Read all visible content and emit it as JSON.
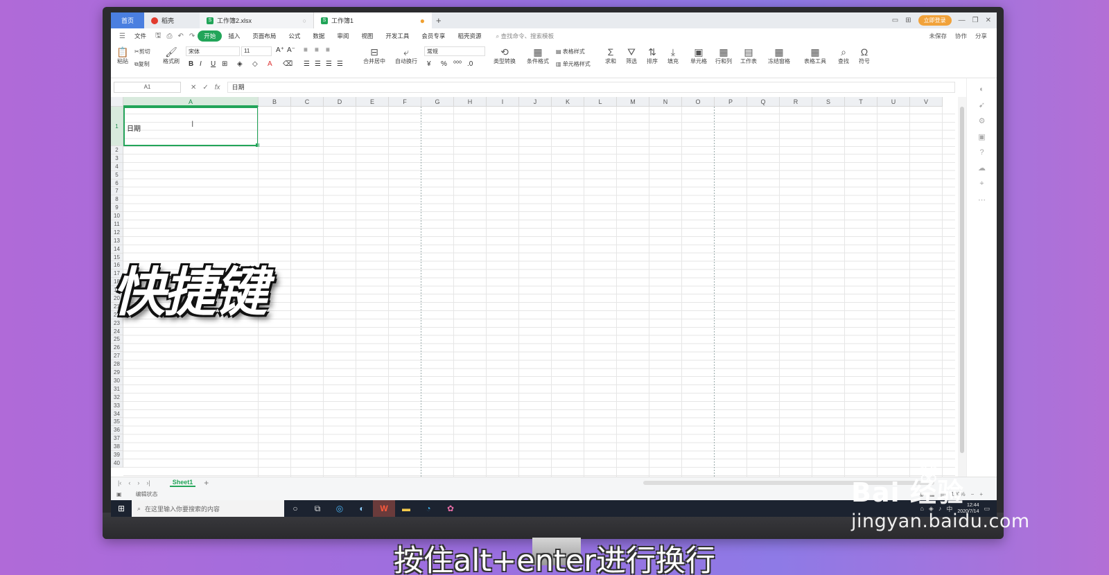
{
  "tabs": {
    "home": "首页",
    "docer": "稻壳",
    "file1": "工作簿2.xlsx",
    "active": "工作簿1",
    "new_tab": "+"
  },
  "title_bar": {
    "login": "立即登录"
  },
  "menu": {
    "file": "文件",
    "items": [
      "开始",
      "插入",
      "页面布局",
      "公式",
      "数据",
      "审阅",
      "视图",
      "开发工具",
      "会员专享",
      "稻壳资源"
    ],
    "active_index": 0,
    "search": "查找命令、搜索模板",
    "unsaved": "未保存",
    "collab": "协作",
    "share": "分享"
  },
  "ribbon": {
    "paste": "粘贴",
    "cut": "剪切",
    "copy": "复制",
    "format_painter": "格式刷",
    "font_name": "宋体",
    "font_size": "11",
    "merge_center": "合并居中",
    "wrap_text": "自动换行",
    "number_format": "常规",
    "type_convert": "类型转换",
    "cond_format": "条件格式",
    "table_style": "表格样式",
    "cell_style": "单元格样式",
    "sum": "求和",
    "filter": "筛选",
    "sort": "排序",
    "fill": "填充",
    "cell": "单元格",
    "row_col": "行和列",
    "worksheet": "工作表",
    "freeze": "冻结窗格",
    "table_tools": "表格工具",
    "find": "查找",
    "symbol": "符号"
  },
  "formula_bar": {
    "cell_ref": "A1",
    "fx": "fx",
    "value": "日期"
  },
  "grid": {
    "columns": [
      "A",
      "B",
      "C",
      "D",
      "E",
      "F",
      "G",
      "H",
      "I",
      "J",
      "K",
      "L",
      "M",
      "N",
      "O",
      "P",
      "Q",
      "R",
      "S",
      "T",
      "U",
      "V"
    ],
    "rows": [
      "1",
      "2",
      "3",
      "4",
      "5",
      "6",
      "7",
      "8",
      "9",
      "10",
      "11",
      "12",
      "13",
      "14",
      "15",
      "16",
      "17",
      "18",
      "19",
      "20",
      "21",
      "22",
      "23",
      "24",
      "25",
      "26",
      "27",
      "28",
      "29",
      "30",
      "31",
      "32",
      "33",
      "34",
      "35",
      "36",
      "37",
      "38",
      "39",
      "40"
    ],
    "active_cell_text": "日期"
  },
  "sheet_bar": {
    "sheet_name": "Sheet1",
    "add": "+"
  },
  "status_bar": {
    "state": "编辑状态",
    "zoom": "100%"
  },
  "taskbar": {
    "search_placeholder": "在这里输入你要搜索的内容",
    "ime": "中",
    "time": "12:44",
    "date": "2020/7/14"
  },
  "overlay": {
    "title": "快捷键",
    "subtitle": "按住alt+enter进行换行"
  },
  "watermark": {
    "brand": "Bai 经验",
    "url": "jingyan.baidu.com"
  }
}
